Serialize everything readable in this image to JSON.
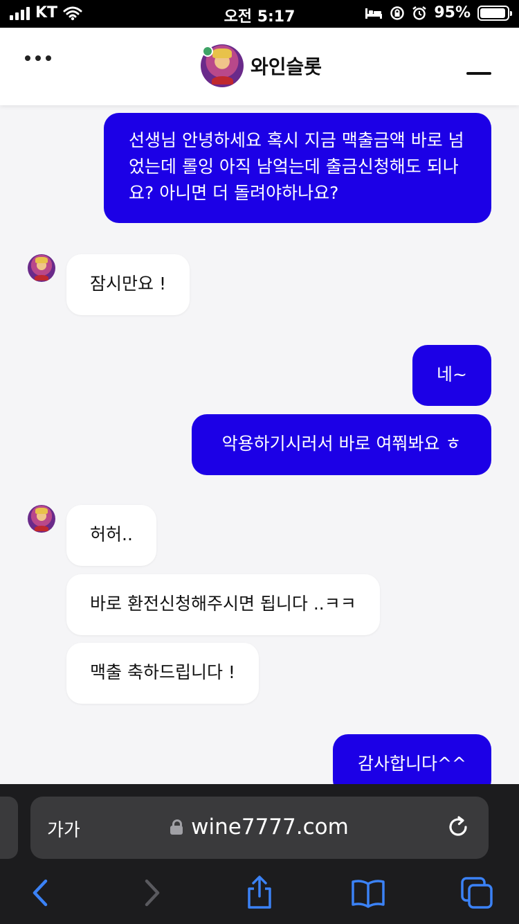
{
  "status_bar": {
    "carrier": "KT",
    "time": "오전 5:17",
    "battery_percent": "95%",
    "battery_level": 0.95
  },
  "header": {
    "title": "와인슬롯",
    "online": true
  },
  "messages": [
    {
      "side": "me",
      "text": "선생님 안녕하세요 혹시 지금 맥출금액 바로 넘었는데 롤잉 아직 남엌는데 출금신청해도 되나요? 아니면 더 돌려야하나요?"
    },
    {
      "side": "them",
      "text": "잠시만요 !"
    },
    {
      "side": "me",
      "text": "네~"
    },
    {
      "side": "me",
      "text": "악용하기시러서 바로 여쭤봐요 ㅎ"
    },
    {
      "side": "them",
      "text": "허허.."
    },
    {
      "side": "them",
      "text": "바로 환전신청해주시면 됩니다 ..ㅋㅋ"
    },
    {
      "side": "them",
      "text": "맥출 축하드립니다 !"
    },
    {
      "side": "me",
      "text": "감사합니다^^"
    }
  ],
  "browser": {
    "text_size_label": "가가",
    "url": "wine7777.com"
  },
  "colors": {
    "my_bubble": "#1c00e6",
    "their_bubble": "#ffffff",
    "chat_background": "#f5f5f7",
    "online_dot": "#3ea366",
    "browser_accent": "#3b82f6"
  },
  "icons": [
    "wifi-icon",
    "bed-icon",
    "lock-rotation-icon",
    "alarm-icon",
    "lock-icon",
    "reload-icon",
    "back-icon",
    "forward-icon",
    "share-icon",
    "bookmarks-icon",
    "tabs-icon"
  ]
}
